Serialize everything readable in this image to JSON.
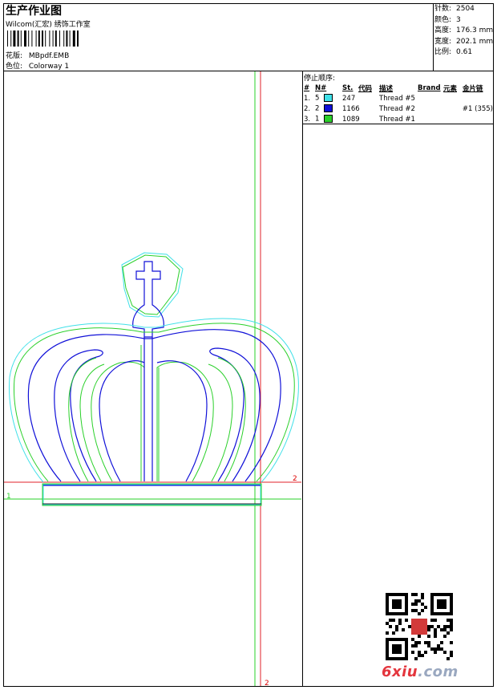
{
  "header": {
    "title": "生产作业图",
    "company": "Wilcom(汇宏) 绣饰工作室",
    "design_label": "花版:",
    "design_value": "MBpdf.EMB",
    "colorway_label": "色位:",
    "colorway_value": "Colorway 1"
  },
  "stats": [
    {
      "label": "针数:",
      "value": "2504"
    },
    {
      "label": "颜色:",
      "value": "3"
    },
    {
      "label": "高度:",
      "value": "176.3 mm"
    },
    {
      "label": "宽度:",
      "value": "202.1 mm"
    },
    {
      "label": "比例:",
      "value": "0.61"
    }
  ],
  "stop_sequence": {
    "title": "停止顺序:",
    "headers": [
      "#",
      "N#",
      "St.",
      "代码",
      "描述",
      "Brand",
      "元素",
      "金片链"
    ],
    "rows": [
      {
        "n": "1.",
        "num": "5",
        "color": "#3fe0e8",
        "st": "247",
        "desc": "Thread #5",
        "extra": ""
      },
      {
        "n": "2.",
        "num": "2",
        "color": "#1010d8",
        "st": "1166",
        "desc": "Thread #2",
        "extra": "#1 (355)"
      },
      {
        "n": "3.",
        "num": "1",
        "color": "#2ad02a",
        "st": "1089",
        "desc": "Thread #1",
        "extra": ""
      }
    ]
  },
  "guides": {
    "h_label": "1",
    "v_label_top": "2",
    "v_label_bottom": "2"
  },
  "watermark": {
    "text_a": "6xiu",
    "text_b": ".com"
  },
  "colors": {
    "cyan": "#3fe0e8",
    "blue": "#1010d8",
    "green": "#2ad02a",
    "guide": "#e0202a",
    "guide_green": "#2ad02a"
  }
}
